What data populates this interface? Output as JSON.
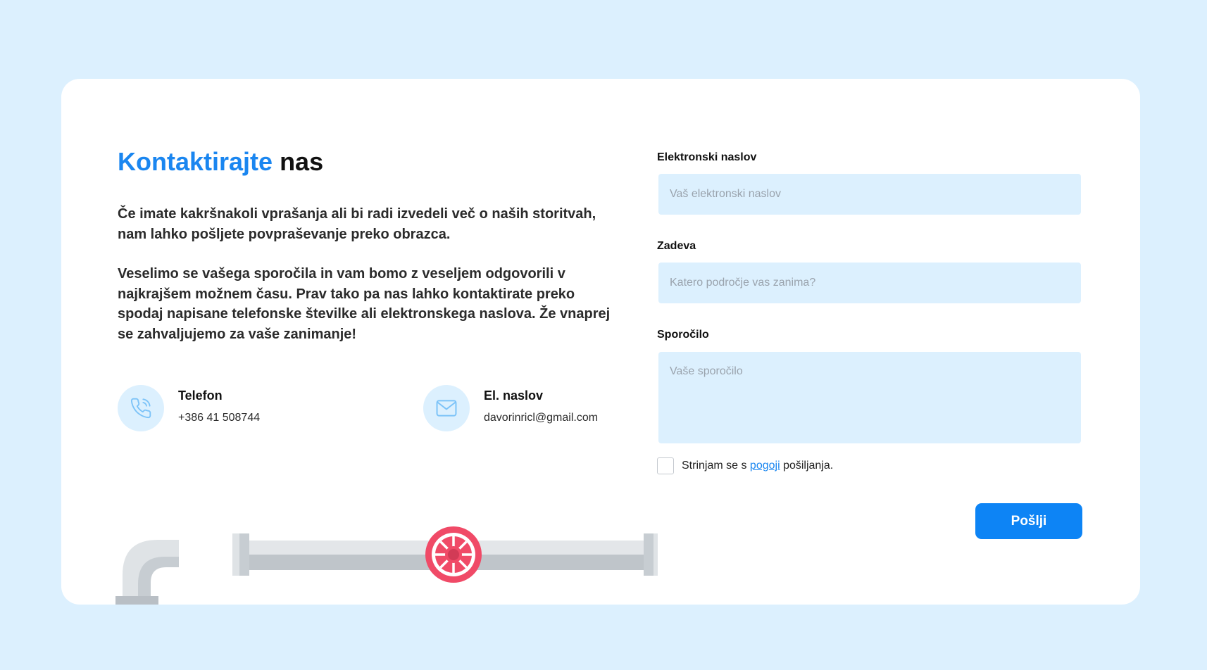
{
  "heading": {
    "accent": "Kontaktirajte",
    "rest": "nas"
  },
  "intro": {
    "paragraph1": "Če imate kakršnakoli vprašanja ali bi radi izvedeli več o naših storitvah, nam lahko pošljete povpraševanje preko obrazca.",
    "paragraph2": "Veselimo se vašega sporočila in vam bomo z veseljem odgovorili v najkrajšem možnem času. Prav tako pa nas lahko kontaktirate preko spodaj napisane telefonske številke ali elektronskega naslova. Že vnaprej se zahvaljujemo za vaše zanimanje!"
  },
  "contacts": {
    "phone": {
      "label": "Telefon",
      "value": "+386 41 508744",
      "icon": "phone-icon"
    },
    "email": {
      "label": "El. naslov",
      "value": "davorinricl@gmail.com",
      "icon": "mail-icon"
    }
  },
  "form": {
    "email": {
      "label": "Elektronski naslov",
      "placeholder": "Vaš elektronski naslov",
      "value": ""
    },
    "subject": {
      "label": "Zadeva",
      "placeholder": "Katero področje vas zanima?",
      "value": ""
    },
    "message": {
      "label": "Sporočilo",
      "placeholder": "Vaše sporočilo",
      "value": ""
    },
    "consent": {
      "prefix": "Strinjam se s ",
      "link": "pogoji",
      "suffix": " pošiljanja.",
      "checked": false
    },
    "submit_label": "Pošlji"
  },
  "colors": {
    "background": "#dcf0fe",
    "accent": "#1a86f0",
    "button": "#0d84f5",
    "valve": "#f04a67"
  }
}
